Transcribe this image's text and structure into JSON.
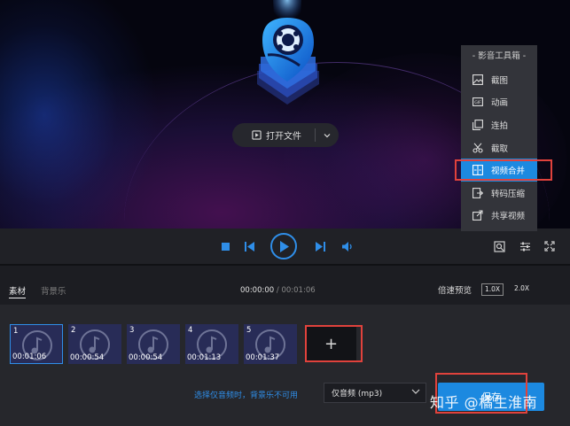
{
  "player": {
    "open_file_label": "打开文件"
  },
  "toolbox": {
    "title": "- 影音工具箱 -",
    "items": [
      {
        "label": "截图",
        "icon": "image-icon"
      },
      {
        "label": "动画",
        "icon": "gif-icon"
      },
      {
        "label": "连拍",
        "icon": "burst-icon"
      },
      {
        "label": "截取",
        "icon": "scissors-icon"
      },
      {
        "label": "视频合并",
        "icon": "merge-icon",
        "active": true
      },
      {
        "label": "转码压缩",
        "icon": "transcode-icon"
      },
      {
        "label": "共享视频",
        "icon": "share-icon"
      }
    ]
  },
  "tabs": {
    "material": "素材",
    "bgm": "背景乐"
  },
  "timeline": {
    "current": "00:00:00",
    "separator": " / ",
    "total": "00:01:06",
    "speed_label": "倍速预览",
    "speed_1": "1.0X",
    "speed_2": "2.0X"
  },
  "clips": [
    {
      "num": "1",
      "duration": "00:01:06",
      "selected": true
    },
    {
      "num": "2",
      "duration": "00:00:54"
    },
    {
      "num": "3",
      "duration": "00:00:54"
    },
    {
      "num": "4",
      "duration": "00:01:13"
    },
    {
      "num": "5",
      "duration": "00:01:37"
    }
  ],
  "add_label": "+",
  "footer": {
    "hint": "选择仅音频时，背景乐不可用",
    "format_value": "仅音频 (mp3)",
    "save_label": "保存",
    "watermark": "知乎 @橘生淮南"
  },
  "colors": {
    "accent": "#1c89e0",
    "highlight_box": "#e0423c",
    "clip_bg": "#282c57"
  }
}
